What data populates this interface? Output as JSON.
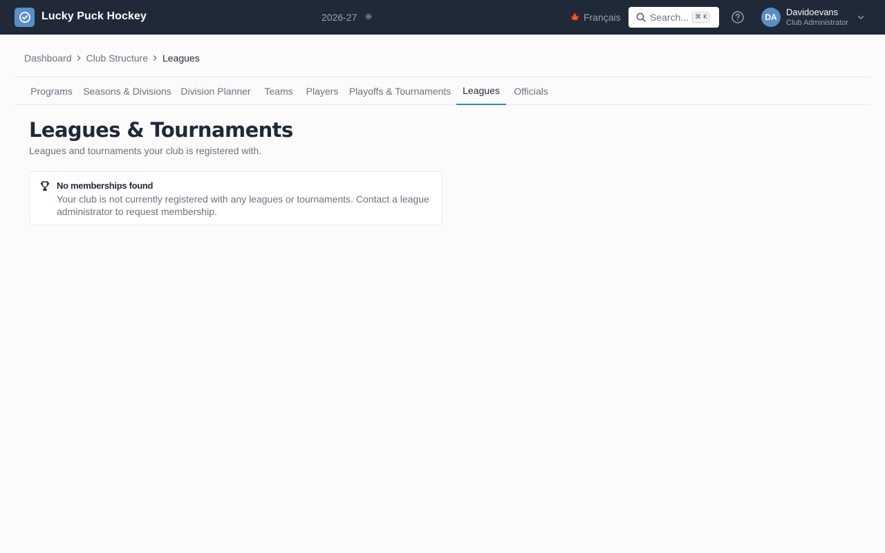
{
  "app": {
    "title": "Lucky Puck Hockey",
    "season": "2026-27",
    "language": "Français",
    "brand_color": "#5b8ec9",
    "topbar_color": "#1f2937"
  },
  "search": {
    "placeholder": "Search...",
    "shortcut": "⌘ K"
  },
  "user": {
    "initials": "DA",
    "name": "Davidoevans",
    "role": "Club Administrator"
  },
  "breadcrumb": [
    {
      "label": "Dashboard"
    },
    {
      "label": "Club Structure"
    },
    {
      "label": "Leagues"
    }
  ],
  "tabs": [
    {
      "label": "Programs"
    },
    {
      "label": "Seasons & Divisions"
    },
    {
      "label": "Division Planner"
    },
    {
      "label": "Teams"
    },
    {
      "label": "Players"
    },
    {
      "label": "Playoffs & Tournaments"
    },
    {
      "label": "Leagues",
      "active": true
    },
    {
      "label": "Officials"
    }
  ],
  "page": {
    "title": "Leagues & Tournaments",
    "subtitle": "Leagues and tournaments your club is registered with."
  },
  "empty_state": {
    "icon": "trophy-icon",
    "title": "No memberships found",
    "message": "Your club is not currently registered with any leagues or tournaments. Contact a league administrator to request membership."
  },
  "colors": {
    "active_tab_underline": "#3b82c4",
    "maple_leaf": "#dc2626"
  }
}
